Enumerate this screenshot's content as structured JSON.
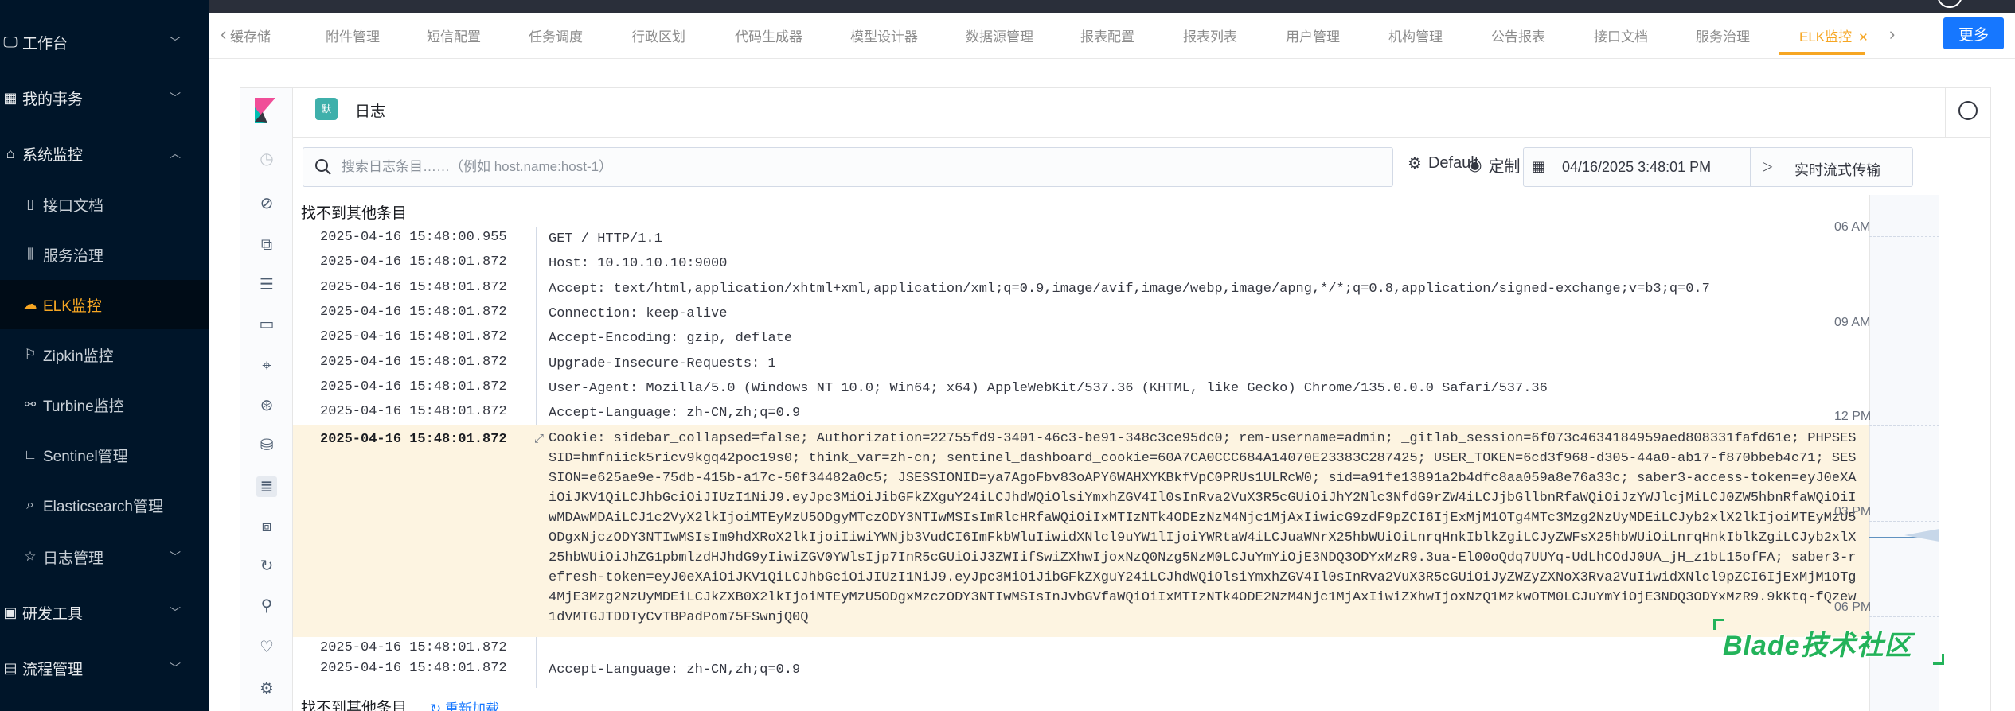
{
  "sidebar": {
    "groups": [
      {
        "label": "工作台",
        "icon": "monitor-icon",
        "expanded": false
      },
      {
        "label": "我的事务",
        "icon": "grid-icon",
        "expanded": false
      },
      {
        "label": "系统监控",
        "icon": "bank-icon",
        "expanded": true
      },
      {
        "label": "研发工具",
        "icon": "tool-icon",
        "expanded": false
      },
      {
        "label": "流程管理",
        "icon": "flow-icon",
        "expanded": false
      }
    ],
    "items": [
      {
        "label": "接口文档",
        "icon": "doc-icon"
      },
      {
        "label": "服务治理",
        "icon": "chart-icon"
      },
      {
        "label": "ELK监控",
        "icon": "cloud-icon",
        "active": true
      },
      {
        "label": "Zipkin监控",
        "icon": "flag-icon"
      },
      {
        "label": "Turbine监控",
        "icon": "cluster-icon"
      },
      {
        "label": "Sentinel管理",
        "icon": "corner-icon"
      },
      {
        "label": "Elasticsearch管理",
        "icon": "search-icon"
      },
      {
        "label": "日志管理",
        "icon": "star-icon",
        "expandable": true
      }
    ]
  },
  "tabs": {
    "items": [
      "缓存储",
      "附件管理",
      "短信配置",
      "任务调度",
      "行政区划",
      "代码生成器",
      "模型设计器",
      "数据源管理",
      "报表配置",
      "报表列表",
      "用户管理",
      "机构管理",
      "公告报表",
      "接口文档",
      "服务治理",
      "ELK监控"
    ],
    "active": "ELK监控",
    "more_label": "更多"
  },
  "kibana": {
    "space_badge": "默",
    "title": "日志",
    "search_placeholder": "搜索日志条目……（例如 host.name:host-1）",
    "settings_label": "Default",
    "customize_label": "定制",
    "date_value": "04/16/2025 3:48:01 PM",
    "stream_label": "实时流式传输",
    "no_more_top": "找不到其他条目",
    "no_more_bottom": "找不到其他条目",
    "reload_label": "重新加载"
  },
  "log_entries": [
    {
      "ts": "2025-04-16 15:48:00.955",
      "msg": "GET / HTTP/1.1"
    },
    {
      "ts": "2025-04-16 15:48:01.872",
      "msg": "Host: 10.10.10.10:9000"
    },
    {
      "ts": "2025-04-16 15:48:01.872",
      "msg": "Accept: text/html,application/xhtml+xml,application/xml;q=0.9,image/avif,image/webp,image/apng,*/*;q=0.8,application/signed-exchange;v=b3;q=0.7"
    },
    {
      "ts": "2025-04-16 15:48:01.872",
      "msg": "Connection: keep-alive"
    },
    {
      "ts": "2025-04-16 15:48:01.872",
      "msg": "Accept-Encoding: gzip, deflate"
    },
    {
      "ts": "2025-04-16 15:48:01.872",
      "msg": "Upgrade-Insecure-Requests: 1"
    },
    {
      "ts": "2025-04-16 15:48:01.872",
      "msg": "User-Agent: Mozilla/5.0 (Windows NT 10.0; Win64; x64) AppleWebKit/537.36 (KHTML, like Gecko) Chrome/135.0.0.0 Safari/537.36"
    },
    {
      "ts": "2025-04-16 15:48:01.872",
      "msg": "Accept-Language: zh-CN,zh;q=0.9"
    },
    {
      "ts": "2025-04-16 15:48:01.872",
      "msg": "Cookie: sidebar_collapsed=false; Authorization=22755fd9-3401-46c3-be91-348c3ce95dc0; rem-username=admin; _gitlab_session=6f073c4634184959aed808331fafd61e; PHPSESSID=hmfniick5ricv9kgq42poc19s0; think_var=zh-cn; sentinel_dashboard_cookie=60A7CA0CCC684A14070E23383C287425; USER_TOKEN=6cd3f968-d305-44a0-ab17-f870bbeb4c71; SESSION=e625ae9e-75db-415b-a17c-50f34482a0c5; JSESSIONID=ya7AgoFbv83oAPY6WAHXYKBkfVpC0PRUs1ULRcW0; sid=a91fe13891a2b4dfc8aa059a8e76a33c; saber3-access-token=eyJ0eXAiOiJKV1QiLCJhbGciOiJIUzI1NiJ9.eyJpc3MiOiJibGFkZXguY24iLCJhdWQiOlsiYmxhZGV4Il0sInRva2VuX3R5cGUiOiJhY2Nlc3NfdG9rZW4iLCJjbGllbnRfaWQiOiJzYWJlcjMiLCJ0ZW5hbnRfaWQiOiIwMDAwMDAiLCJ1c2VyX2lkIjoiMTEyMzU5ODgyMTczODY3NTIwMSIsImRlcHRfaWQiOiIxMTIzNTk4ODEzNzM4Njc1MjAxIiwicG9zdF9pZCI6IjExMjM1OTg4MTc3Mzg2NzUyMDEiLCJyb2xlX2lkIjoiMTEyMzU5ODgxNjczODY3NTIwMSIsIm9hdXRoX2lkIjoiIiwiYWNjb3VudCI6ImFkbWluIiwidXNlcl9uYW1lIjoiYWRtaW4iLCJuaWNrX25hbWUiOiLnrqHnkIblkZgiLCJyZWFsX25hbWUiOiLnrqHnkIblkZgiLCJyb2xlX25hbWUiOiJhZG1pbmlzdHJhdG9yIiwiZGV0YWlsIjp7InR5cGUiOiJ3ZWIifSwiZXhwIjoxNzQ0Nzg5NzM0LCJuYmYiOjE3NDQ3ODYxMzR9.3ua-El00oQdq7UUYq-UdLhCOdJ0UA_jH_z1bL15ofFA; saber3-refresh-token=eyJ0eXAiOiJKV1QiLCJhbGciOiJIUzI1NiJ9.eyJpc3MiOiJibGFkZXguY24iLCJhdWQiOlsiYmxhZGV4Il0sInRva2VuX3R5cGUiOiJyZWZyZXNoX3Rva2VuIiwidXNlcl9pZCI6IjExMjM1OTg4MjE3Mzg2NzUyMDEiLCJkZXB0X2lkIjoiMTEyMzU5ODgxMzczODY3NTIwMSIsInJvbGVfaWQiOiIxMTIzNTk4ODE2NzM4Njc1MjAxIiwiZXhwIjoxNzQ1MzkwOTM0LCJuYmYiOjE3NDQ3ODYxMzR9.9kKtq-fQzew1dVMTGJTDDTyCvTBPadPom75FSwnjQ0Q",
      "highlight": true
    },
    {
      "ts": "2025-04-16 15:48:01.872",
      "msg": ""
    },
    {
      "ts": "2025-04-16 15:48:01.872",
      "msg": "Accept-Language: zh-CN,zh;q=0.9"
    }
  ],
  "minimap": {
    "labels": [
      "06 AM",
      "09 AM",
      "12 PM",
      "03 PM",
      "06 PM"
    ]
  },
  "watermark": "Blade技术社区",
  "colors": {
    "sidebar_bg": "#001529",
    "accent": "#f6a623",
    "primary": "#1677ff",
    "highlight_row": "#fdf4e1",
    "kibana_badge": "#3fb0ab",
    "watermark": "#23b35a"
  }
}
